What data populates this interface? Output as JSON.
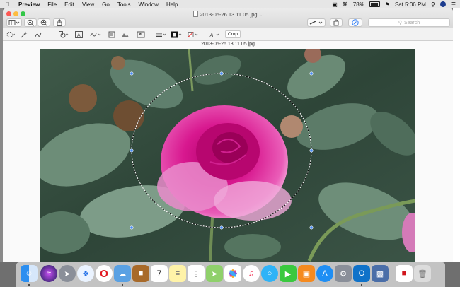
{
  "menubar": {
    "app_name": "Preview",
    "menus": [
      "File",
      "Edit",
      "View",
      "Go",
      "Tools",
      "Window",
      "Help"
    ],
    "battery": "78%",
    "clock": "Sat 5:06 PM"
  },
  "window": {
    "title": "2013-05-26 13.11.05.jpg",
    "search_placeholder": "Search",
    "crop_label": "Crop",
    "image_label": "2013-05-26 13.11.05.jpg"
  },
  "dock": {
    "items": [
      "Finder",
      "Siri",
      "Launchpad",
      "Safari",
      "Opera",
      "Preview",
      "Notefile",
      "Calendar",
      "Notes",
      "Reminders",
      "Maps",
      "Photos",
      "Music",
      "Messages",
      "FaceTime",
      "Books",
      "App Store",
      "System Preferences",
      "Outlook",
      "Photos Library",
      "Adobe",
      "Trash"
    ],
    "calendar_day": "7"
  },
  "colors": {
    "accent": "#2f7cf6",
    "close": "#fc5753",
    "minimize": "#fdbc40",
    "maximize": "#33c748"
  }
}
